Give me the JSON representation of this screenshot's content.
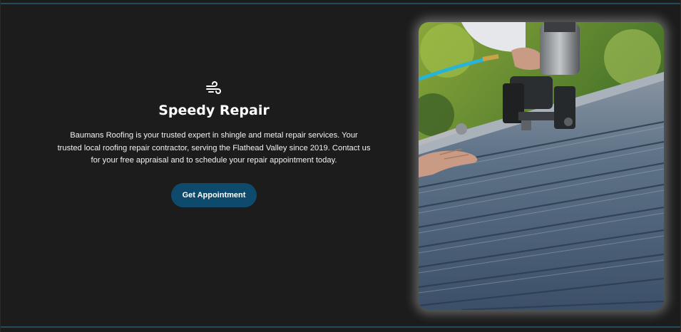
{
  "section": {
    "icon": "wind-icon",
    "title": "Speedy Repair",
    "description": "Baumans Roofing is your trusted expert in shingle and metal repair services. Your trusted local roofing repair contractor, serving the Flathead Valley since 2019. Contact us for your free appraisal and to schedule your repair appointment today.",
    "cta_label": "Get Appointment"
  },
  "photo": {
    "subject": "roofer-nailing-shingles-photo"
  },
  "colors": {
    "background": "#1c1c1c",
    "accent_rule": "#1f4d5c",
    "button": "#0e4a6b",
    "text": "#ffffff"
  }
}
